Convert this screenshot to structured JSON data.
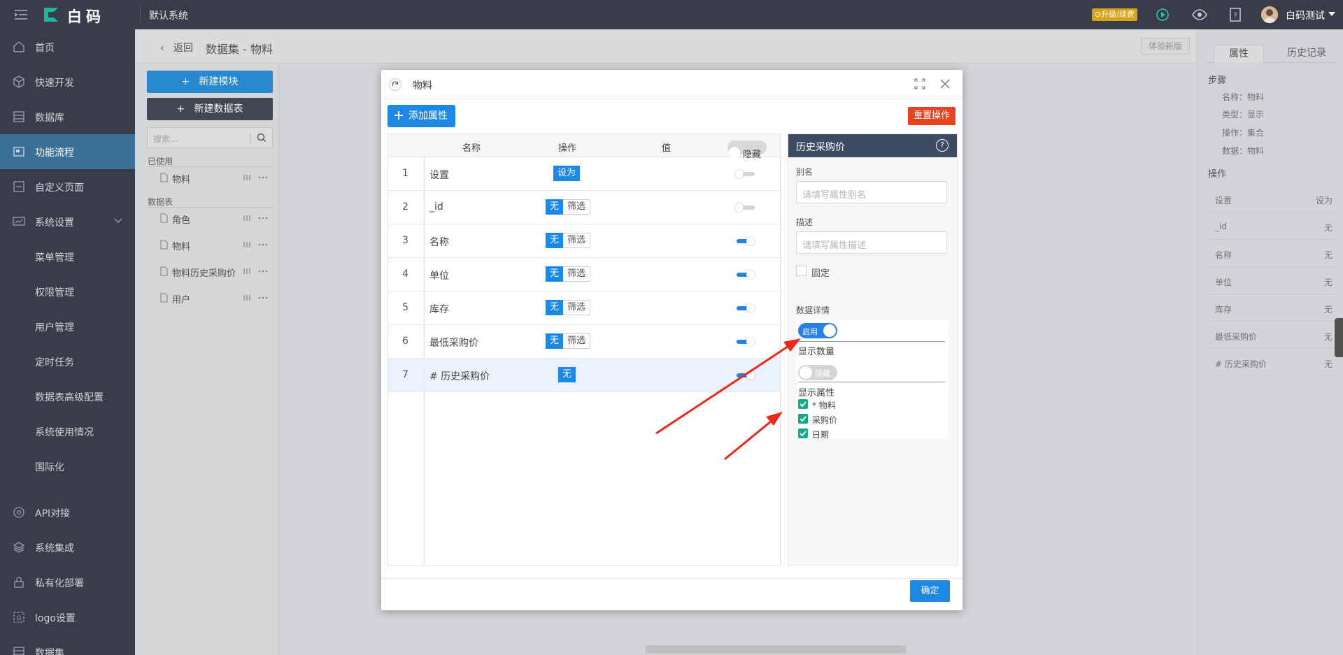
{
  "topbar": {
    "brand": "白码",
    "system": "默认系统",
    "upgrade": "⊙升级/续费",
    "username": "白码测试",
    "icons": [
      "menu-icon",
      "play-icon",
      "eye-icon",
      "help-icon",
      "chevron-down-icon"
    ]
  },
  "sidebar": {
    "items": [
      {
        "label": "首页",
        "icon": "home-icon"
      },
      {
        "label": "快速开发",
        "icon": "cube-icon"
      },
      {
        "label": "数据库",
        "icon": "database-icon"
      },
      {
        "label": "功能流程",
        "icon": "flow-icon",
        "active": true
      },
      {
        "label": "自定义页面",
        "icon": "page-icon"
      },
      {
        "label": "系统设置",
        "icon": "settings-icon"
      }
    ],
    "sub_items": [
      "菜单管理",
      "权限管理",
      "用户管理",
      "定时任务",
      "数据表高级配置",
      "系统使用情况",
      "国际化"
    ],
    "bottom_items": [
      {
        "label": "API对接",
        "icon": "api-icon"
      },
      {
        "label": "系统集成",
        "icon": "layers-icon"
      },
      {
        "label": "私有化部署",
        "icon": "lock-icon"
      },
      {
        "label": "logo设置",
        "icon": "logo-icon"
      },
      {
        "label": "数据集",
        "icon": "dataset-icon"
      }
    ]
  },
  "page": {
    "back": "返回",
    "breadcrumb": "数据集 - 物料",
    "experience": "体验新版",
    "new_module": "新建模块",
    "new_table": "新建数据表",
    "search_placeholder": "搜索...",
    "used_title": "已使用",
    "used_items": [
      "物料"
    ],
    "tables_title": "数据表",
    "tables": [
      "角色",
      "物料",
      "物料历史采购价",
      "用户"
    ]
  },
  "right_panel": {
    "tabs": [
      "属性",
      "历史记录"
    ],
    "step_title": "步骤",
    "step_kv": [
      "名称：物料",
      "类型：显示",
      "操作：集合",
      "数据：物料"
    ],
    "ops_title": "操作",
    "ops": [
      {
        "k": "设置",
        "v": "设为"
      },
      {
        "k": "_id",
        "v": "无"
      },
      {
        "k": "名称",
        "v": "无"
      },
      {
        "k": "单位",
        "v": "无"
      },
      {
        "k": "库存",
        "v": "无"
      },
      {
        "k": "最低采购价",
        "v": "无"
      },
      {
        "k": "# 历史采购价",
        "v": "无"
      }
    ]
  },
  "dialog": {
    "title": "物料",
    "add_attr": "添加属性",
    "reset": "重置操作",
    "confirm": "确定",
    "headers": {
      "name": "名称",
      "op": "操作",
      "value": "值",
      "hide": "隐藏"
    },
    "rows": [
      {
        "no": "1",
        "name": "设置",
        "op": "设为",
        "filter": "",
        "on": false
      },
      {
        "no": "2",
        "name": "_id",
        "op": "无",
        "filter": "筛选",
        "on": false
      },
      {
        "no": "3",
        "name": "名称",
        "op": "无",
        "filter": "筛选",
        "on": true
      },
      {
        "no": "4",
        "name": "单位",
        "op": "无",
        "filter": "筛选",
        "on": true
      },
      {
        "no": "5",
        "name": "库存",
        "op": "无",
        "filter": "筛选",
        "on": true
      },
      {
        "no": "6",
        "name": "最低采购价",
        "op": "无",
        "filter": "筛选",
        "on": true
      },
      {
        "no": "7",
        "name": "# 历史采购价",
        "op": "无",
        "filter": "",
        "on": true
      }
    ],
    "props": {
      "title": "历史采购价",
      "alias_label": "别名",
      "alias_placeholder": "请填写属性别名",
      "desc_label": "描述",
      "desc_placeholder": "请填写属性描述",
      "fixed_label": "固定",
      "details_label": "数据详情",
      "enable_label": "启用",
      "show_count_label": "显示数量",
      "hide_label": "隐藏",
      "show_props_label": "显示属性",
      "checked_props": [
        "* 物料",
        "采购价",
        "日期"
      ]
    }
  },
  "colors": {
    "accent": "#1e88e5",
    "danger": "#e8421e",
    "sidebar": "#393d49",
    "arrow": "#e8291c"
  }
}
